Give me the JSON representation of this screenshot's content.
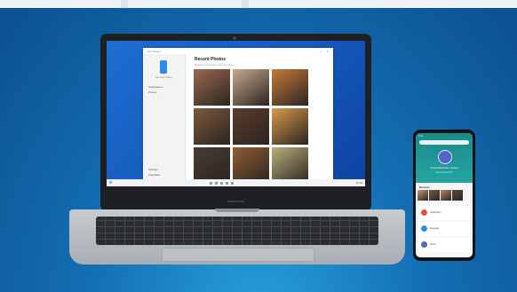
{
  "colors": {
    "background": "#1470b4",
    "accent": "#1c6fd0",
    "phone_header": "#1c8a8a"
  },
  "laptop": {
    "brand": "SAMSUNG",
    "app": {
      "title": "Your Phone",
      "window_controls": "–  ▢  ✕",
      "phone_label": "Samsung Galaxy",
      "nav": [
        "Notifications",
        "Photos"
      ],
      "nav_bottom": [
        "Settings",
        "Feedback"
      ],
      "photos_title": "Recent Photos",
      "photos_subtitle": "Showing recent photos from your phone",
      "photos": [
        {
          "name": "photo-children",
          "color": "#9a6a4f"
        },
        {
          "name": "photo-girl",
          "color": "#c8a98e"
        },
        {
          "name": "photo-cupcakes",
          "color": "#c87a3a"
        },
        {
          "name": "photo-tree",
          "color": "#7c5a3a"
        },
        {
          "name": "photo-mother-child",
          "color": "#5b3c2c"
        },
        {
          "name": "photo-dog",
          "color": "#d89a4a"
        },
        {
          "name": "photo-man",
          "color": "#4a3c34"
        },
        {
          "name": "photo-latte",
          "color": "#8f5e34"
        },
        {
          "name": "photo-ocean-girl",
          "color": "#b8b07a"
        }
      ]
    },
    "taskbar": {
      "start_icon": "windows-start-icon",
      "clock": "10:30"
    }
  },
  "phone": {
    "status": "9:41",
    "user_name": "Good afternoon, Susan",
    "user_sub": "Connected to PC",
    "section_title": "Recents",
    "photos": [
      "#c79a7a",
      "#7a5a4a",
      "#b88a6a",
      "#5a4a3a"
    ],
    "list": [
      {
        "icon_color": "#e5533d",
        "text": "Notification"
      },
      {
        "icon_color": "#2a8be8",
        "text": "Message"
      },
      {
        "icon_color": "#4f66c8",
        "text": "Photo"
      }
    ]
  }
}
